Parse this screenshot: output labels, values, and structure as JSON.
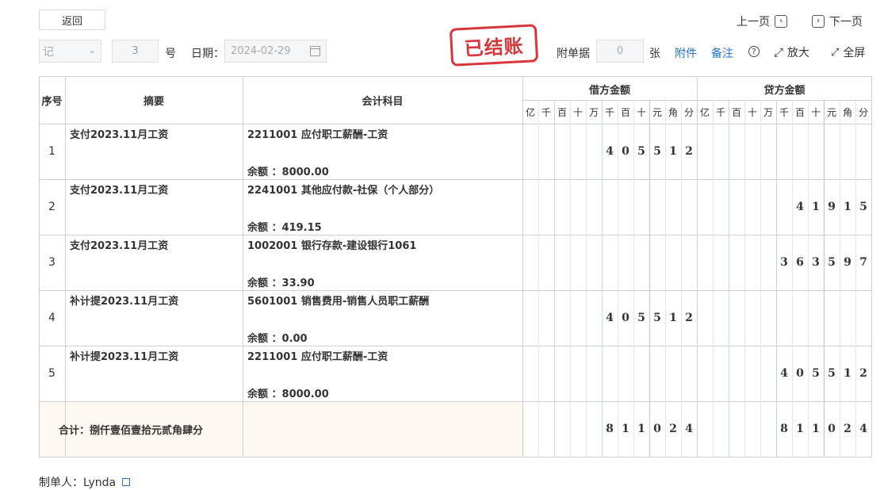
{
  "toolbar": {
    "back_label": "返回",
    "prev_label": "上一页",
    "next_label": "下一页",
    "voucher_type": "记",
    "voucher_no": "3",
    "no_suffix": "号",
    "date_label": "日期：",
    "date_value": "2024-02-29",
    "stamp": "已结账",
    "attach_label": "附单据",
    "attach_count": "0",
    "attach_unit": "张",
    "attachment_link": "附件",
    "remark_link": "备注",
    "zoom_label": "放大",
    "fullscreen_label": "全屏"
  },
  "table": {
    "headers": {
      "seq": "序号",
      "summary": "摘要",
      "account": "会计科目",
      "debit": "借方金额",
      "credit": "贷方金额"
    },
    "units": [
      "亿",
      "千",
      "百",
      "十",
      "万",
      "千",
      "百",
      "十",
      "元",
      "角",
      "分"
    ],
    "rows": [
      {
        "seq": "1",
        "summary": "支付2023.11月工资",
        "account": "2211001 应付职工薪酬-工资",
        "balance": "余额 ：8000.00",
        "debit": "405512",
        "credit": ""
      },
      {
        "seq": "2",
        "summary": "支付2023.11月工资",
        "account": "2241001 其他应付款-社保（个人部分）",
        "balance": "余额 ：419.15",
        "debit": "",
        "credit": "41915"
      },
      {
        "seq": "3",
        "summary": "支付2023.11月工资",
        "account": "1002001 银行存款-建设银行1061",
        "balance": "余额 ：33.90",
        "debit": "",
        "credit": "363597"
      },
      {
        "seq": "4",
        "summary": "补计提2023.11月工资",
        "account": "5601001 销售费用-销售人员职工薪酬",
        "balance": "余额 ：0.00",
        "debit": "405512",
        "credit": ""
      },
      {
        "seq": "5",
        "summary": "补计提2023.11月工资",
        "account": "2211001 应付职工薪酬-工资",
        "balance": "余额 ：8000.00",
        "debit": "",
        "credit": "405512"
      }
    ],
    "total": {
      "label": "合计：捌仟壹佰壹拾元贰角肆分",
      "debit": "811024",
      "credit": "811024"
    }
  },
  "footer": {
    "maker": "制单人：Lynda"
  }
}
